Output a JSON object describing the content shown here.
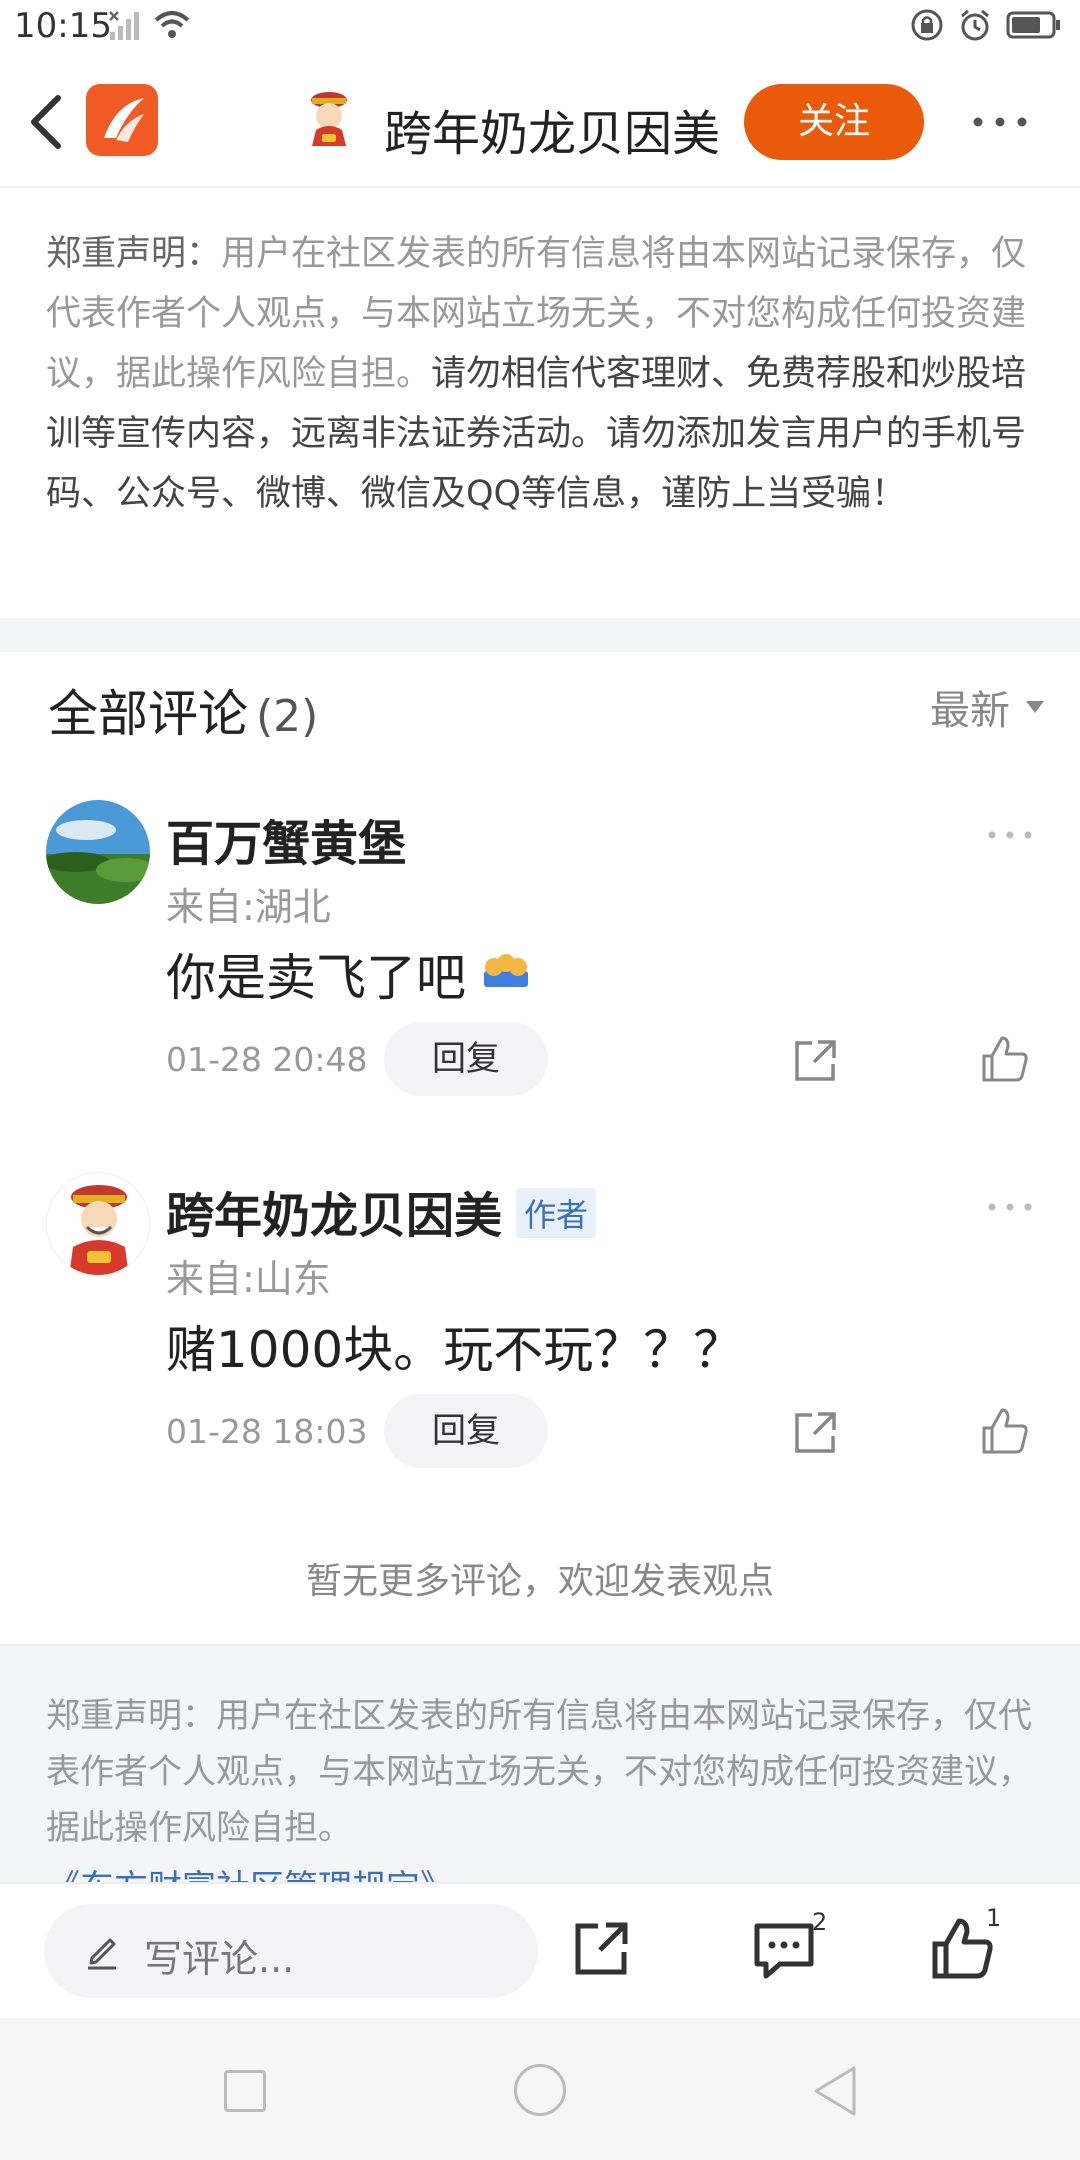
{
  "status_bar": {
    "time": "10:15"
  },
  "header": {
    "title": "跨年奶龙贝因美",
    "follow_label": "关注"
  },
  "disclaimer_top": {
    "label": "郑重声明：",
    "gray_text": "用户在社区发表的所有信息将由本网站记录保存，仅代表作者个人观点，与本网站立场无关，不对您构成任何投资建议，据此操作风险自担。",
    "dark_text": "请勿相信代客理财、免费荐股和炒股培训等宣传内容，远离非法证券活动。请勿添加发言用户的手机号码、公众号、微博、微信及QQ等信息，谨防上当受骗！"
  },
  "comments_section": {
    "title": "全部评论",
    "count": "(2)",
    "sort_label": "最新"
  },
  "comments": [
    {
      "name": "百万蟹黄堡",
      "location": "来自:湖北",
      "text": "你是卖飞了吧",
      "time": "01-28 20:48",
      "reply_label": "回复"
    },
    {
      "name": "跨年奶龙贝因美",
      "author_tag": "作者",
      "location": "来自:山东",
      "text": "赌1000块。玩不玩？？？",
      "time": "01-28 18:03",
      "reply_label": "回复"
    }
  ],
  "no_more_text": "暂无更多评论，欢迎发表观点",
  "disclaimer_bottom": {
    "text": "郑重声明：用户在社区发表的所有信息将由本网站记录保存，仅代表作者个人观点，与本网站立场无关，不对您构成任何投资建议，据此操作风险自担。",
    "link": "《东方财富社区管理规定》"
  },
  "action_bar": {
    "input_placeholder": "写评论...",
    "comment_badge": "2",
    "like_badge": "1"
  },
  "colors": {
    "accent": "#ea5a0b",
    "link": "#3b6fb6"
  }
}
